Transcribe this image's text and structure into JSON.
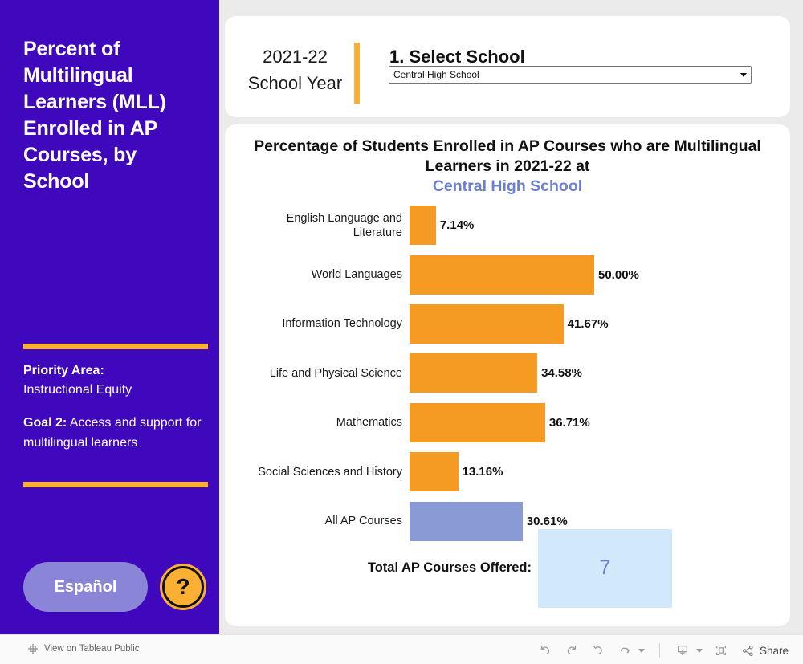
{
  "sidebar": {
    "title": "Percent of Multilingual Learners (MLL) Enrolled in AP Courses, by School",
    "priority_label": "Priority Area:",
    "priority_value": "Instructional Equity",
    "goal_label": "Goal 2:",
    "goal_text": " Access and support for multilingual learners",
    "espanol_label": "Español",
    "help_glyph": "?",
    "background_color": "#4008BD",
    "accent_color": "#FBB034"
  },
  "controls": {
    "school_year": "2021-22\nSchool Year",
    "school_year_line1": "2021-22",
    "school_year_line2": "School Year",
    "select_school_label": "1. Select School",
    "school_selected": "Central High School",
    "school_options": [
      "Central High School"
    ]
  },
  "chart_panel": {
    "title_line1": "Percentage of Students Enrolled in AP Courses who",
    "title_line2": "are Multilingual Learners in 2021-22 at",
    "title_school": "Central High School",
    "total_label": "Total AP Courses Offered:",
    "total_value": "7"
  },
  "chart_data": {
    "type": "bar",
    "orientation": "horizontal",
    "title": "Percentage of Students Enrolled in AP Courses who are Multilingual Learners in 2021-22 at Central High School",
    "xlabel": "",
    "ylabel": "",
    "xlim": [
      0,
      50
    ],
    "grid": false,
    "legend": "none",
    "categories": [
      "English Language and Literature",
      "World Languages",
      "Information Technology",
      "Life and Physical Science",
      "Mathematics",
      "Social Sciences and History",
      "All AP Courses"
    ],
    "values": [
      7.14,
      50.0,
      41.67,
      34.58,
      36.71,
      13.16,
      30.61
    ],
    "value_labels": [
      "7.14%",
      "50.00%",
      "41.67%",
      "34.58%",
      "36.71%",
      "13.16%",
      "30.61%"
    ],
    "colors": [
      "#F59A23",
      "#F59A23",
      "#F59A23",
      "#F59A23",
      "#F59A23",
      "#F59A23",
      "#8A9AD4"
    ],
    "bars": [
      {
        "label_line1": "English Language and",
        "label_line2": "Literature",
        "value": 7.14,
        "value_label": "7.14%",
        "color": "#F59A23"
      },
      {
        "label_line1": "World Languages",
        "label_line2": "",
        "value": 50.0,
        "value_label": "50.00%",
        "color": "#F59A23"
      },
      {
        "label_line1": "Information Technology",
        "label_line2": "",
        "value": 41.67,
        "value_label": "41.67%",
        "color": "#F59A23"
      },
      {
        "label_line1": "Life and Physical Science",
        "label_line2": "",
        "value": 34.58,
        "value_label": "34.58%",
        "color": "#F59A23"
      },
      {
        "label_line1": "Mathematics",
        "label_line2": "",
        "value": 36.71,
        "value_label": "36.71%",
        "color": "#F59A23"
      },
      {
        "label_line1": "Social Sciences and History",
        "label_line2": "",
        "value": 13.16,
        "value_label": "13.16%",
        "color": "#F59A23"
      },
      {
        "label_line1": "All AP Courses",
        "label_line2": "",
        "value": 30.61,
        "value_label": "30.61%",
        "color": "#8A9AD4"
      }
    ]
  },
  "toolbar": {
    "tableau_link_label": "View on Tableau Public",
    "share_label": "Share",
    "buttons": [
      "undo-icon",
      "redo-icon",
      "revert-icon",
      "refresh-icon",
      "download-icon",
      "fullscreen-icon",
      "share-icon"
    ]
  }
}
